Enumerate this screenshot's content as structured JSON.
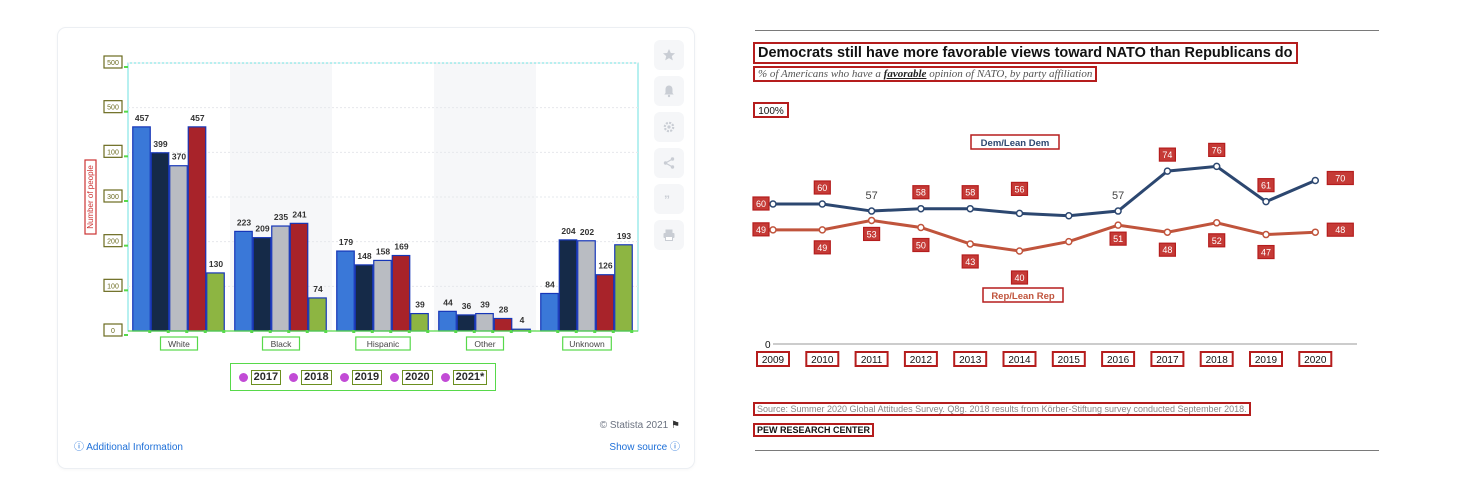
{
  "left_panel": {
    "y_ticks": [
      "500",
      "500",
      "100",
      "300",
      "200",
      "100",
      "0"
    ],
    "y_axis_label": "Number of people",
    "legend": [
      "2017",
      "2018",
      "2019",
      "2020",
      "2021*"
    ],
    "footer_credit": "© Statista 2021",
    "additional_info": "Additional Information",
    "show_source": "Show source",
    "tool_icons": [
      "star-icon",
      "bell-icon",
      "gear-icon",
      "share-icon",
      "quote-icon",
      "print-icon"
    ]
  },
  "right_panel": {
    "title": "Democrats still have more favorable views toward NATO than Republicans do",
    "subtitle_pre": "% of Americans who have a ",
    "subtitle_em": "favorable",
    "subtitle_post": " opinion of NATO, by party affiliation",
    "hundred_label": "100%",
    "zero_label": "0",
    "source": "Source: Summer 2020 Global Attitudes Survey. Q8g. 2018 results from Körber-Stiftung survey conducted September 2018.",
    "brand": "PEW RESEARCH CENTER"
  },
  "chart_data": [
    {
      "type": "bar",
      "categories": [
        "White",
        "Black",
        "Hispanic",
        "Other",
        "Unknown"
      ],
      "series": [
        {
          "name": "2017",
          "values": [
            457,
            223,
            179,
            44,
            84
          ],
          "color": "#3a78d8"
        },
        {
          "name": "2018",
          "values": [
            399,
            209,
            148,
            36,
            204
          ],
          "color": "#152a48"
        },
        {
          "name": "2019",
          "values": [
            370,
            235,
            158,
            39,
            202
          ],
          "color": "#b9bcc2"
        },
        {
          "name": "2020",
          "values": [
            457,
            241,
            169,
            28,
            126
          ],
          "color": "#a8232a"
        },
        {
          "name": "2021*",
          "values": [
            130,
            74,
            39,
            4,
            193
          ],
          "color": "#8db542"
        }
      ],
      "ylim": [
        0,
        600
      ],
      "ylabel": "Number of people",
      "legend_position": "bottom",
      "grid": true
    },
    {
      "type": "line",
      "title": "Democrats still have more favorable views toward NATO than Republicans do",
      "x": [
        "2009",
        "2010",
        "2011",
        "2012",
        "2013",
        "2014",
        "2015",
        "2016",
        "2017",
        "2018",
        "2019",
        "2020"
      ],
      "series": [
        {
          "name": "Dem/Lean Dem",
          "values": [
            60,
            60,
            57,
            58,
            58,
            56,
            55,
            57,
            74,
            76,
            61,
            70
          ],
          "labels": [
            "60",
            "60",
            "57",
            "58",
            "58",
            "56",
            null,
            "57",
            "74",
            "76",
            "61",
            "70"
          ],
          "color": "#2c4770"
        },
        {
          "name": "Rep/Lean Rep",
          "values": [
            49,
            49,
            53,
            50,
            43,
            40,
            44,
            51,
            48,
            52,
            47,
            48
          ],
          "labels": [
            "49",
            "49",
            "53",
            "50",
            "43",
            "40",
            null,
            "51",
            "48",
            "52",
            "47",
            "48"
          ],
          "color": "#c0543c"
        }
      ],
      "ylim": [
        0,
        100
      ],
      "legend_position": "inline"
    }
  ]
}
